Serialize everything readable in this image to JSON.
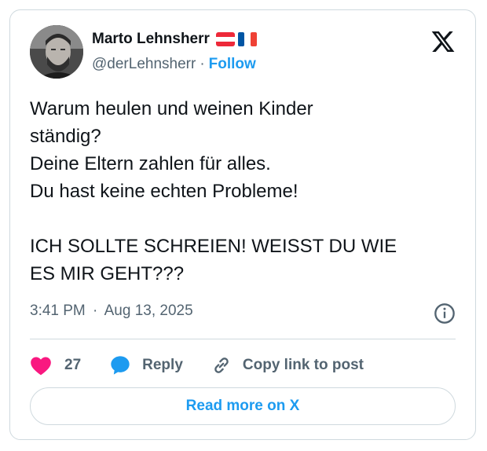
{
  "author": {
    "name": "Marto Lehnsherr",
    "handle": "@derLehnsherr",
    "separator": "·",
    "follow_label": "Follow",
    "flags": [
      "austria-flag-icon",
      "france-flag-icon"
    ]
  },
  "tweet": {
    "text": "Warum heulen und weinen Kinder\nständig?\nDeine Eltern zahlen für alles.\nDu hast keine echten Probleme!\n\nICH SOLLTE SCHREIEN! WEISST DU WIE\nES MIR GEHT???",
    "time": "3:41 PM",
    "separator": "·",
    "date": "Aug 13, 2025"
  },
  "actions": {
    "like_count": "27",
    "reply_label": "Reply",
    "copy_label": "Copy link to post"
  },
  "read_more_label": "Read more on X",
  "colors": {
    "accent": "#1d9bf0",
    "like": "#f91880",
    "text": "#0f1419",
    "muted": "#536471",
    "border": "#cfd9de"
  }
}
